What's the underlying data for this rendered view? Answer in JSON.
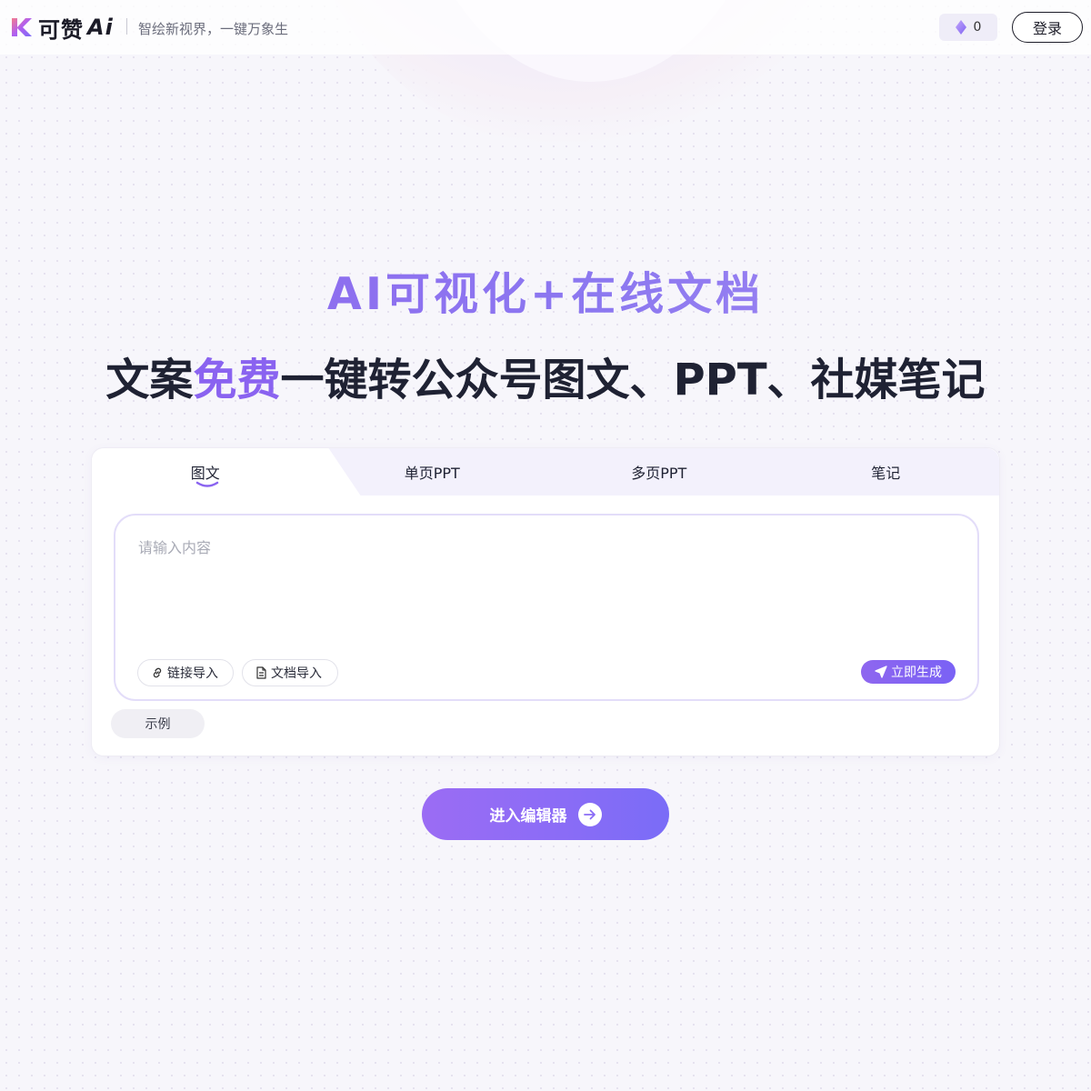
{
  "header": {
    "brand_name": "可赞",
    "brand_suffix": "Ai",
    "slogan": "智绘新视界，一键万象生",
    "points_value": "0",
    "points_icon": "diamond-icon",
    "login_label": "登录"
  },
  "hero": {
    "title": "AI可视化+在线文档",
    "subtitle_prefix": "文案",
    "subtitle_accent": "免费",
    "subtitle_suffix": "一键转公众号图文、PPT、社媒笔记"
  },
  "tabs": [
    {
      "label": "图文",
      "active": true
    },
    {
      "label": "单页PPT",
      "active": false
    },
    {
      "label": "多页PPT",
      "active": false
    },
    {
      "label": "笔记",
      "active": false
    }
  ],
  "editor": {
    "placeholder": "请输入内容",
    "link_import_label": "链接导入",
    "link_import_icon": "link-icon",
    "doc_import_label": "文档导入",
    "doc_import_icon": "document-icon",
    "generate_label": "立即生成",
    "generate_icon": "send-icon",
    "example_label": "示例"
  },
  "cta": {
    "label": "进入编辑器",
    "icon": "arrow-right-icon"
  },
  "colors": {
    "accent": "#8a63f0",
    "button_gradient_start": "#9b6cf4",
    "button_gradient_end": "#7a6cf7"
  }
}
